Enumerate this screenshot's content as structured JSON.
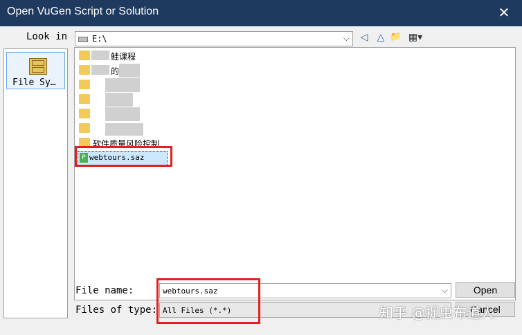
{
  "window": {
    "title": "Open VuGen Script or Solution",
    "close_glyph": "✕"
  },
  "look_in": {
    "label": "Look in",
    "value": "E:\\",
    "arrow": "⌵"
  },
  "toolbar": [
    {
      "name": "back-icon",
      "glyph": "◁"
    },
    {
      "name": "up-folder-icon",
      "glyph": "△"
    },
    {
      "name": "new-folder-icon",
      "glyph": "📁"
    },
    {
      "name": "view-menu-icon",
      "glyph": "▦▾"
    }
  ],
  "left_pane": {
    "item_label": "File Sy…"
  },
  "files": [
    {
      "type": "folder",
      "label": "鲑课程"
    },
    {
      "type": "folder",
      "label": "的"
    },
    {
      "type": "folder",
      "label": ""
    },
    {
      "type": "folder",
      "label": ""
    },
    {
      "type": "folder",
      "label": ""
    },
    {
      "type": "folder",
      "label": ""
    },
    {
      "type": "folder",
      "label": "软件质量风险控制"
    },
    {
      "type": "saz",
      "label": "webtours.saz"
    }
  ],
  "file_name": {
    "label": "File name:",
    "value": "webtours.saz",
    "arrow": "⌵"
  },
  "file_type": {
    "label": "Files of type:",
    "value": "All Files (*.*)"
  },
  "buttons": {
    "open": "Open",
    "cancel": "Cancel"
  },
  "watermark": "知乎 @捉虫布道人",
  "colors": {
    "titlebar": "#1f3a5f",
    "highlight": "#e02020",
    "selection": "#cce8ff"
  }
}
